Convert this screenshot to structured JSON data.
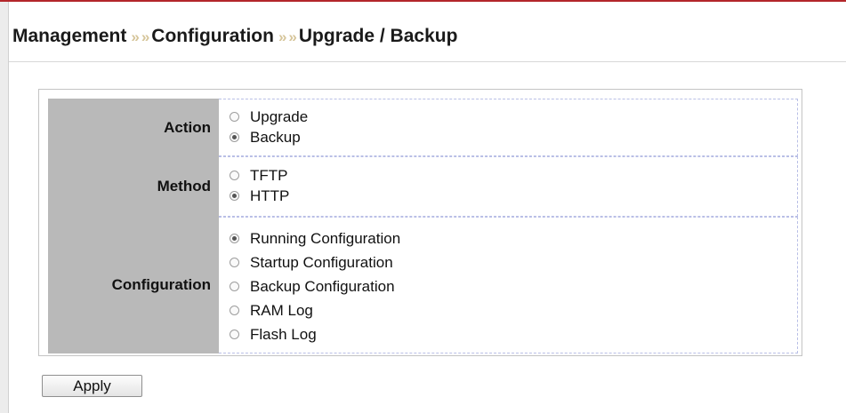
{
  "breadcrumb": {
    "items": [
      "Management",
      "Configuration",
      "Upgrade / Backup"
    ],
    "separator": "»"
  },
  "form": {
    "action": {
      "label": "Action",
      "options": [
        {
          "label": "Upgrade",
          "selected": false
        },
        {
          "label": "Backup",
          "selected": true
        }
      ]
    },
    "method": {
      "label": "Method",
      "options": [
        {
          "label": "TFTP",
          "selected": false
        },
        {
          "label": "HTTP",
          "selected": true
        }
      ]
    },
    "configuration": {
      "label": "Configuration",
      "options": [
        {
          "label": "Running Configuration",
          "selected": true
        },
        {
          "label": "Startup Configuration",
          "selected": false
        },
        {
          "label": "Backup Configuration",
          "selected": false
        },
        {
          "label": "RAM Log",
          "selected": false
        },
        {
          "label": "Flash Log",
          "selected": false
        }
      ]
    }
  },
  "apply_label": "Apply",
  "colors": {
    "label_bg": "#b9b9b9",
    "top_rule": "#b3262a",
    "separator": "#d6c59a",
    "dashed_border": "#b9bfe6"
  }
}
